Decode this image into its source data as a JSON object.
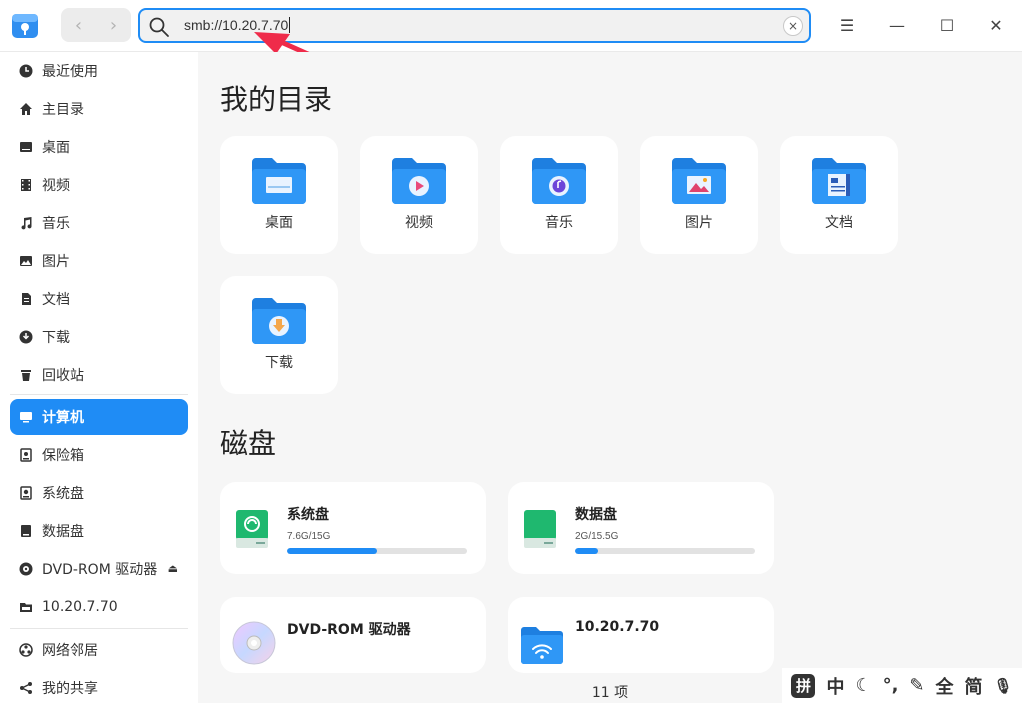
{
  "titlebar": {
    "address": "smb://10.20.7.70",
    "clear_label": "×",
    "back_label": "‹",
    "forward_label": "›",
    "menu_label": "☰",
    "minimize_label": "—",
    "maximize_label": "☐",
    "close_label": "✕"
  },
  "sidebar": {
    "items": [
      {
        "label": "最近使用",
        "icon": "clock-icon"
      },
      {
        "label": "主目录",
        "icon": "home-icon"
      },
      {
        "label": "桌面",
        "icon": "desktop-icon"
      },
      {
        "label": "视频",
        "icon": "video-icon"
      },
      {
        "label": "音乐",
        "icon": "music-icon"
      },
      {
        "label": "图片",
        "icon": "image-icon"
      },
      {
        "label": "文档",
        "icon": "document-icon"
      },
      {
        "label": "下载",
        "icon": "download-icon"
      },
      {
        "label": "回收站",
        "icon": "trash-icon"
      },
      {
        "label": "计算机",
        "icon": "computer-icon"
      },
      {
        "label": "保险箱",
        "icon": "vault-icon"
      },
      {
        "label": "系统盘",
        "icon": "disk-icon"
      },
      {
        "label": "数据盘",
        "icon": "disk-icon"
      },
      {
        "label": "DVD-ROM 驱动器",
        "icon": "cdrom-icon"
      },
      {
        "label": "10.20.7.70",
        "icon": "network-folder-icon"
      },
      {
        "label": "网络邻居",
        "icon": "network-icon"
      },
      {
        "label": "我的共享",
        "icon": "share-icon"
      }
    ],
    "eject_label": "⏏"
  },
  "main": {
    "my_dirs_title": "我的目录",
    "folders": [
      {
        "label": "桌面"
      },
      {
        "label": "视频"
      },
      {
        "label": "音乐"
      },
      {
        "label": "图片"
      },
      {
        "label": "文档"
      },
      {
        "label": "下载"
      }
    ],
    "disks_title": "磁盘",
    "disks": [
      {
        "name": "系统盘",
        "usage": "7.6G/15G",
        "fraction": 0.5
      },
      {
        "name": "数据盘",
        "usage": "2G/15.5G",
        "fraction": 0.13
      },
      {
        "name": "DVD-ROM 驱动器",
        "usage": "",
        "fraction": 0
      },
      {
        "name": "10.20.7.70",
        "usage": "",
        "fraction": 0
      }
    ]
  },
  "status": {
    "count": "11 项"
  },
  "ime": {
    "items": [
      "拼",
      "中",
      "☾",
      "°,",
      "✎",
      "全",
      "简",
      "🎙"
    ]
  },
  "colors": {
    "accent": "#1f8cf5",
    "annotation_arrow": "#ef2b4a",
    "disk_green": "#1fb86f"
  }
}
